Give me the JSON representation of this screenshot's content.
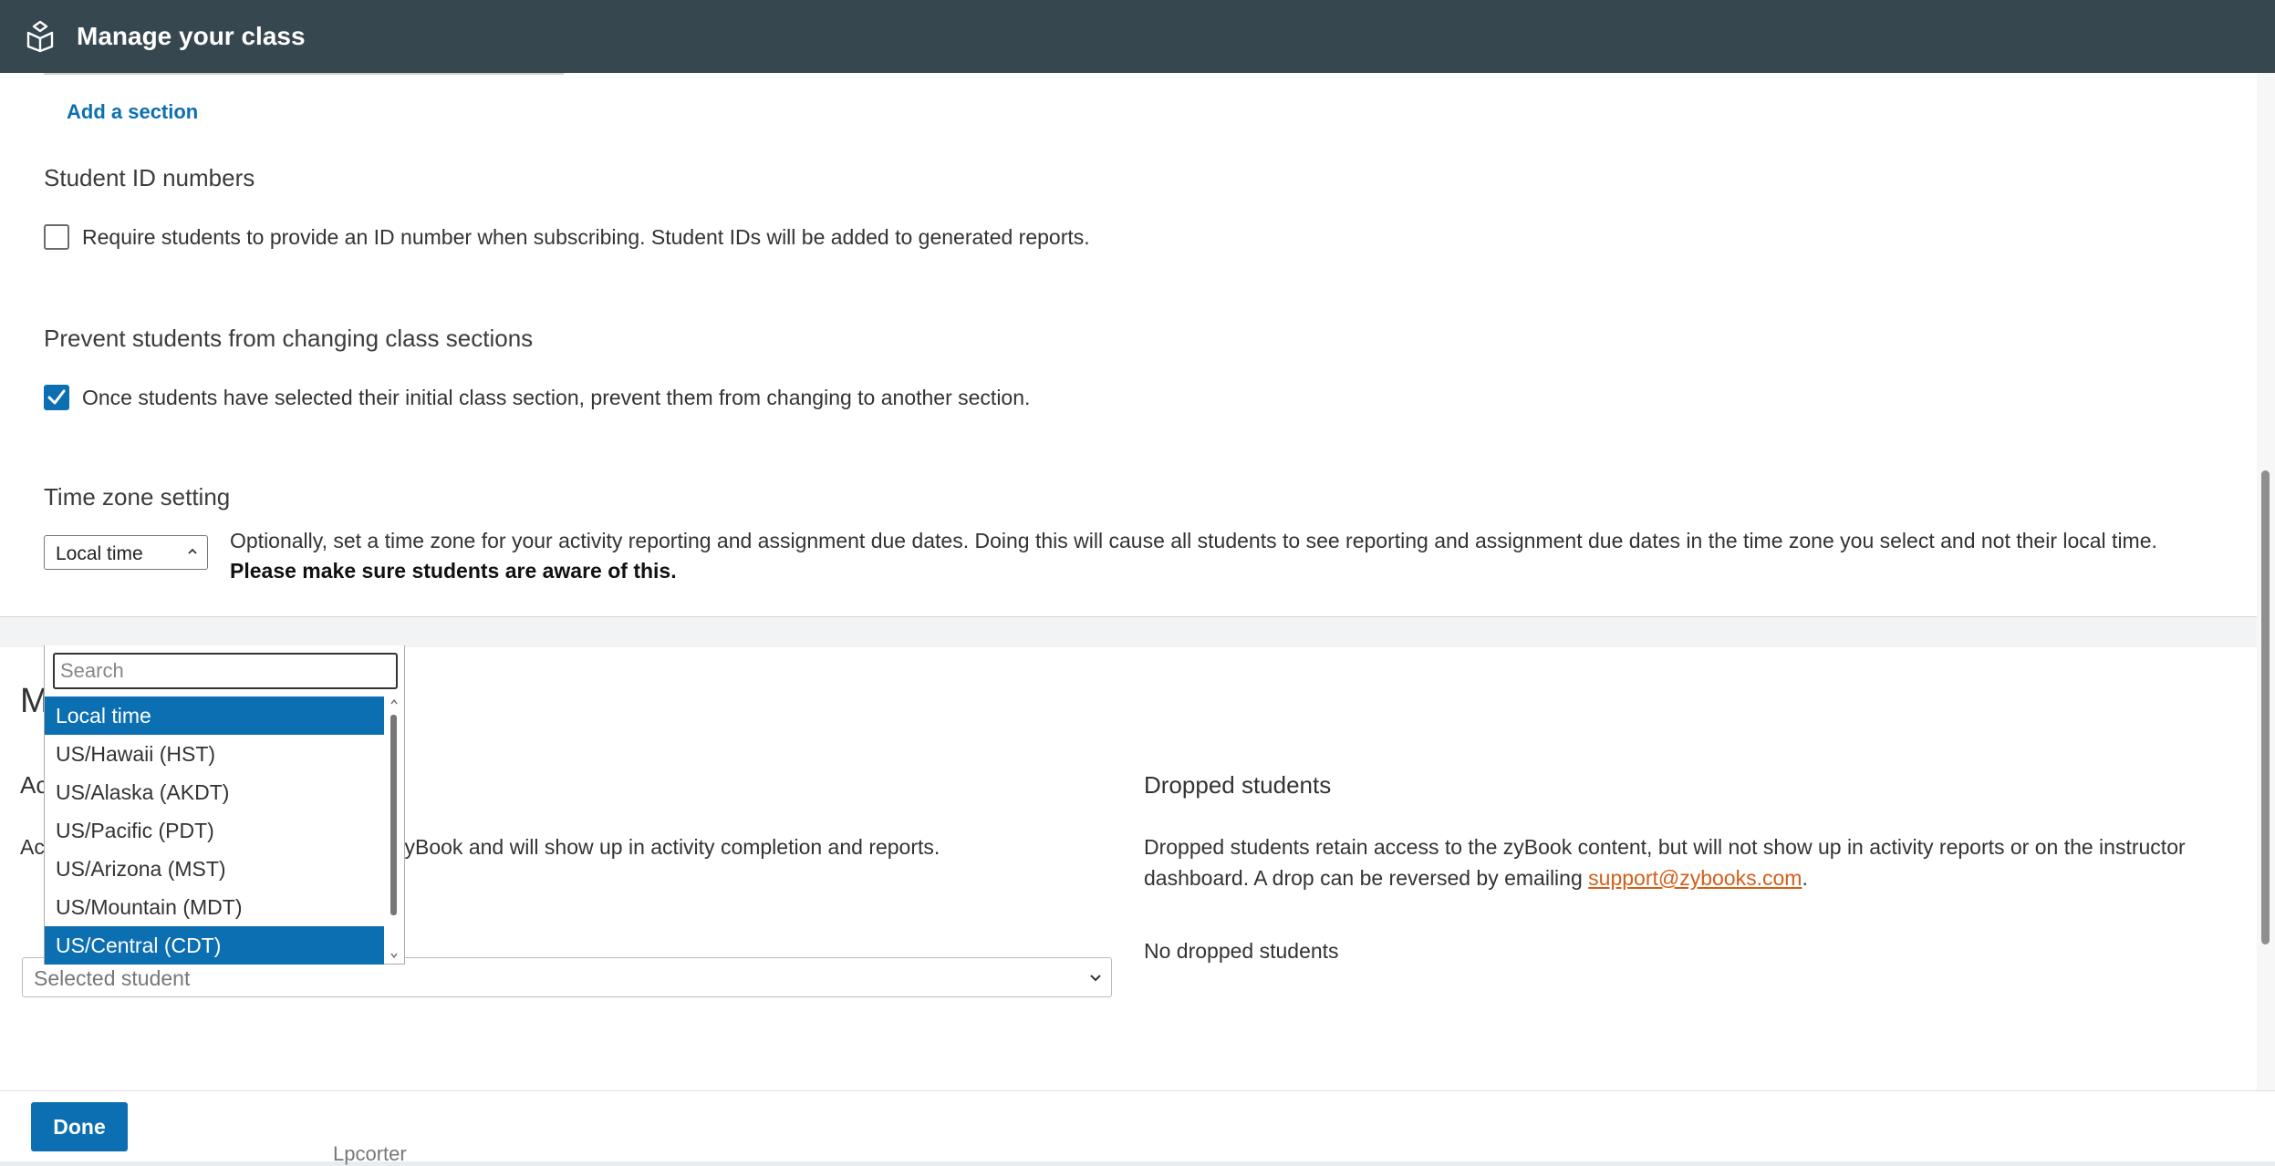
{
  "header": {
    "title": "Manage your class",
    "icon": "zybook-logo-icon"
  },
  "sections": {
    "add_section_label": "Add a section",
    "student_id": {
      "title": "Student ID numbers",
      "checkbox_label": "Require students to provide an ID number when subscribing. Student IDs will be added to generated reports.",
      "checked": false
    },
    "prevent_change": {
      "title": "Prevent students from changing class sections",
      "checkbox_label": "Once students have selected their initial class section, prevent them from changing to another section.",
      "checked": true
    },
    "time_zone": {
      "title": "Time zone setting",
      "selected": "Local time",
      "description": "Optionally, set a time zone for your activity reporting and assignment due dates. Doing this will cause all students to see reporting and assignment due dates in the time zone you select and not their local time.",
      "description_bold": "Please make sure students are aware of this."
    }
  },
  "dropdown": {
    "search_placeholder": "Search",
    "options": [
      {
        "label": "Local time",
        "selected": true
      },
      {
        "label": "US/Hawaii (HST)",
        "selected": false
      },
      {
        "label": "US/Alaska (AKDT)",
        "selected": false
      },
      {
        "label": "US/Pacific (PDT)",
        "selected": false
      },
      {
        "label": "US/Arizona (MST)",
        "selected": false
      },
      {
        "label": "US/Mountain (MDT)",
        "selected": false
      },
      {
        "label": "US/Central (CDT)",
        "selected": true
      }
    ]
  },
  "manage_students": {
    "title_partial": "M",
    "active_partial": "Ac",
    "active_text_partial": "Ac",
    "active_text_rest": "zyBook and will show up in activity completion and reports.",
    "student_select_placeholder": "Selected student",
    "dropped": {
      "title": "Dropped students",
      "description": "Dropped students retain access to the zyBook content, but will not show up in activity reports or on the instructor dashboard. A drop can be reversed by emailing",
      "email": "support@zybooks.com",
      "period": ".",
      "none_text": "No dropped students"
    }
  },
  "footer": {
    "done_label": "Done",
    "behind_text": "Lpcorter"
  },
  "colors": {
    "header_bg": "#37474f",
    "accent": "#0c6fb1",
    "link_orange": "#d35f19"
  }
}
